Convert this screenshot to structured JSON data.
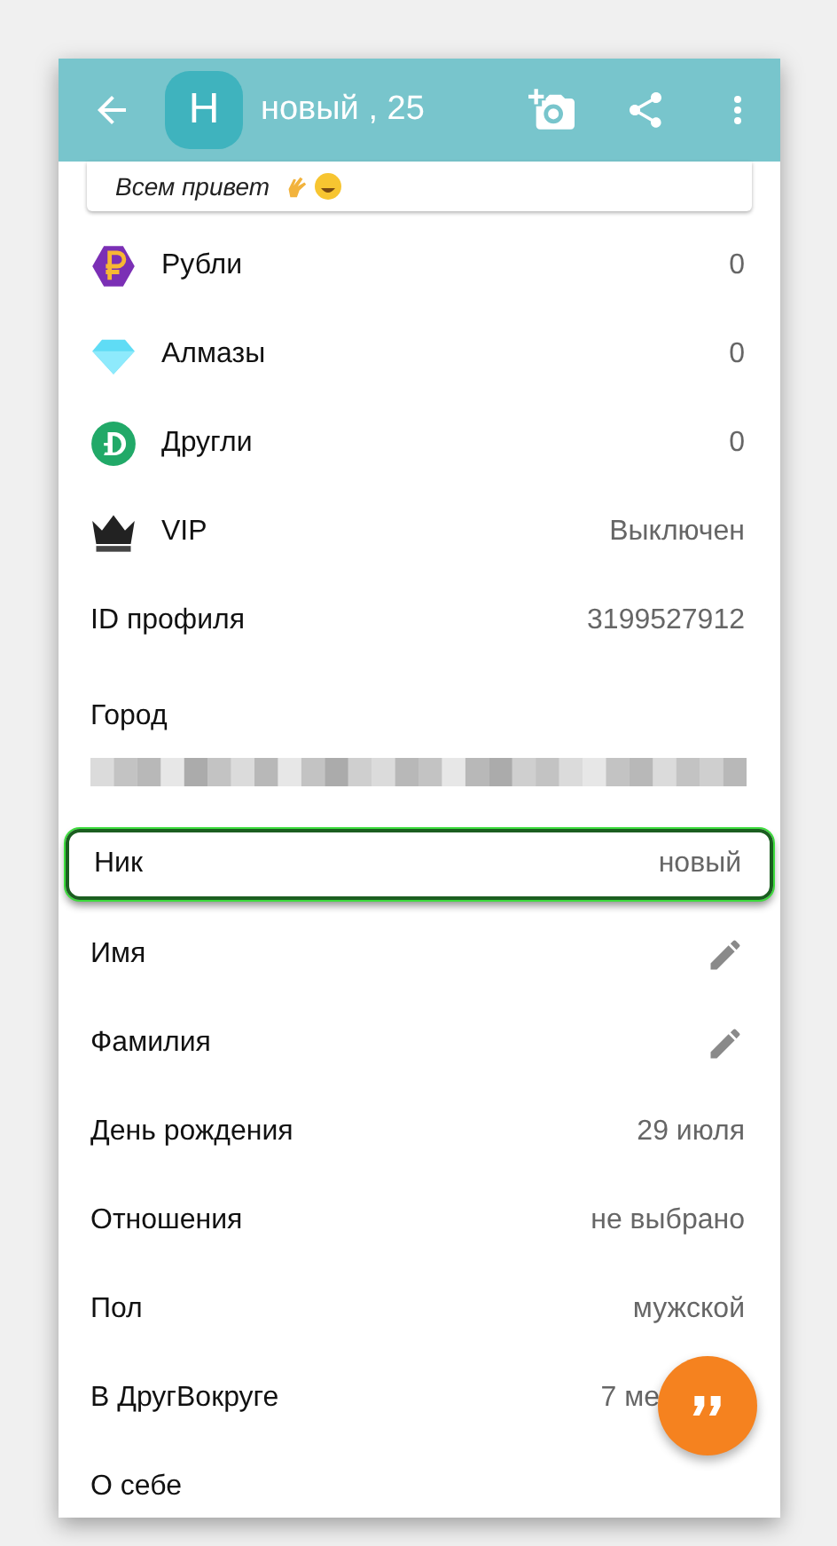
{
  "header": {
    "avatar_letter": "Н",
    "title": "новый , 25"
  },
  "status": {
    "text": "Всем привет"
  },
  "rows": [
    {
      "kind": "rubles",
      "label": "Рубли",
      "value": "0",
      "highlighted": false
    },
    {
      "kind": "diamonds",
      "label": "Алмазы",
      "value": "0",
      "highlighted": false
    },
    {
      "kind": "drugli",
      "label": "Другли",
      "value": "0",
      "highlighted": false
    },
    {
      "kind": "vip",
      "label": "VIP",
      "value": "Выключен",
      "highlighted": false
    },
    {
      "kind": "plain",
      "label": "ID профиля",
      "value": "3199527912",
      "highlighted": false
    },
    {
      "kind": "hidden",
      "label": "Город",
      "highlighted": false
    },
    {
      "kind": "plain",
      "label": "Ник",
      "value": "новый",
      "highlighted": true
    },
    {
      "kind": "edit",
      "label": "Имя",
      "highlighted": false
    },
    {
      "kind": "edit",
      "label": "Фамилия",
      "highlighted": false
    },
    {
      "kind": "plain",
      "label": "День рождения",
      "value": "29 июля",
      "highlighted": false
    },
    {
      "kind": "plain",
      "label": "Отношения",
      "value": "не выбрано",
      "highlighted": false
    },
    {
      "kind": "plain",
      "label": "Пол",
      "value": "мужской",
      "highlighted": false
    },
    {
      "kind": "partial",
      "label": "В ДругВокруге",
      "value": "7 ме",
      "highlighted": false
    },
    {
      "kind": "plain",
      "label": "О себе",
      "highlighted": false
    }
  ]
}
